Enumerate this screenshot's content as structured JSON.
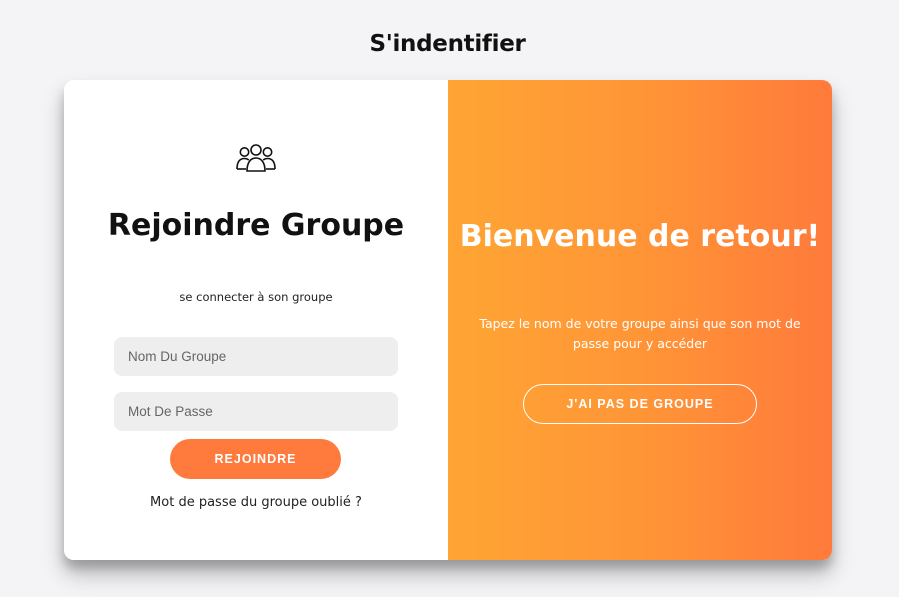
{
  "page": {
    "title": "S'indentifier"
  },
  "login": {
    "icon": "users-group-icon",
    "heading": "Rejoindre Groupe",
    "subtitle": "se connecter à son groupe",
    "group_name_placeholder": "Nom Du Groupe",
    "group_name_value": "",
    "password_placeholder": "Mot De Passe",
    "password_value": "",
    "join_label": "REJOINDRE",
    "forgot_label": "Mot de passe du groupe oublié ?"
  },
  "welcome": {
    "heading": "Bienvenue de retour!",
    "text": "Tapez le nom de votre groupe ainsi que son mot de passe pour y accéder",
    "no_group_label": "J'AI PAS DE GROUPE"
  },
  "colors": {
    "accent": "#ff7b3d",
    "gradient_start": "#ffa534",
    "gradient_end": "#ff7a3b",
    "input_background": "#eeeeee",
    "page_background": "#f4f4f6"
  }
}
